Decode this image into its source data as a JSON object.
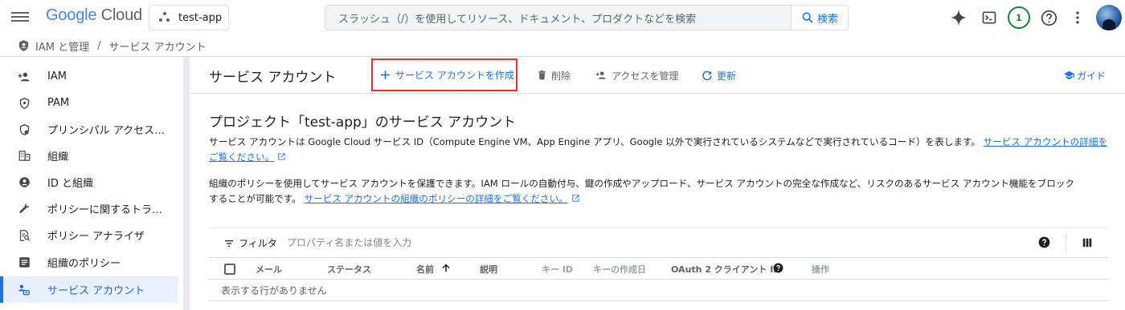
{
  "header": {
    "logo_google": "Google",
    "logo_cloud": "Cloud",
    "project": "test-app",
    "search_placeholder": "スラッシュ（/）を使用してリソース、ドキュメント、プロダクトなどを検索",
    "search_button": "検索",
    "notification_count": "1",
    "icons": [
      "menu-icon",
      "gemini-sparkle-icon",
      "cloud-shell-icon",
      "help-icon",
      "more-vert-icon",
      "avatar"
    ]
  },
  "breadcrumb": {
    "section": "IAM と管理",
    "separator": "/",
    "page": "サービス アカウント"
  },
  "sidebar": {
    "items": [
      {
        "label": "IAM",
        "icon": "person-add-icon"
      },
      {
        "label": "PAM",
        "icon": "shield-icon"
      },
      {
        "label": "プリンシパル アクセス…",
        "icon": "shield-lock-icon"
      },
      {
        "label": "組織",
        "icon": "building-icon"
      },
      {
        "label": "ID と組織",
        "icon": "account-circle-icon"
      },
      {
        "label": "ポリシーに関するトラ…",
        "icon": "wrench-icon"
      },
      {
        "label": "ポリシー アナライザ",
        "icon": "policy-search-icon"
      },
      {
        "label": "組織のポリシー",
        "icon": "list-icon"
      },
      {
        "label": "サービス アカウント",
        "icon": "service-account-icon",
        "active": true
      }
    ]
  },
  "toolbar": {
    "title": "サービス アカウント",
    "create_label": "サービス アカウントを作成",
    "delete_label": "削除",
    "manage_access_label": "アクセスを管理",
    "refresh_label": "更新",
    "guide_label": "ガイド"
  },
  "content": {
    "section_title": "プロジェクト「test-app」のサービス アカウント",
    "para1_text": "サービス アカウントは Google Cloud サービス ID（Compute Engine VM、App Engine アプリ、Google 以外で実行されているシステムなどで実行されているコード）を表します。",
    "para1_link_a": "サービス アカウントの詳細を",
    "para1_link_b": "ご覧ください。",
    "para2_text_a": "組織のポリシーを使用してサービス アカウントを保護できます。IAM ロールの自動付与、鍵の作成やアップロード、サービス アカウントの完全な作成など、リスクのあるサービス アカウント機能をブロック",
    "para2_text_b": "することが可能です。",
    "para2_link": "サービス アカウントの組織のポリシーの詳細をご覧ください。"
  },
  "table": {
    "filter_label": "フィルタ",
    "filter_placeholder": "プロパティ名または値を入力",
    "columns": [
      "メール",
      "ステータス",
      "名前",
      "説明",
      "キー ID",
      "キーの作成日",
      "OAuth 2 クライアント ID",
      "操作"
    ],
    "sort_column": "名前",
    "empty_message": "表示する行がありません"
  },
  "colors": {
    "accent": "#1a73e8",
    "highlight_border": "#e0342b",
    "active_nav_bg": "#e8f0fe",
    "badge_green": "#188038"
  }
}
